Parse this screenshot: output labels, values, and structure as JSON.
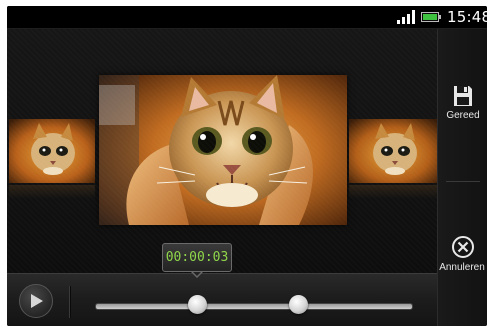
{
  "status_bar": {
    "time": "15:48",
    "signal_icon": "signal-bars-icon",
    "battery_icon": "battery-icon",
    "battery_color": "#3fc23f"
  },
  "viewer": {
    "frames": [
      {
        "role": "previous-thumbnail",
        "subject": "kitten"
      },
      {
        "role": "current-frame",
        "subject": "kitten"
      },
      {
        "role": "next-thumbnail",
        "subject": "kitten"
      }
    ]
  },
  "actions": {
    "save_label": "Gereed",
    "save_icon": "floppy-disk-icon",
    "cancel_label": "Annuleren",
    "cancel_icon": "close-circle-icon"
  },
  "controls": {
    "play_icon": "play-icon",
    "current_time": "00:00:03",
    "accent_color": "#8fd64a"
  }
}
